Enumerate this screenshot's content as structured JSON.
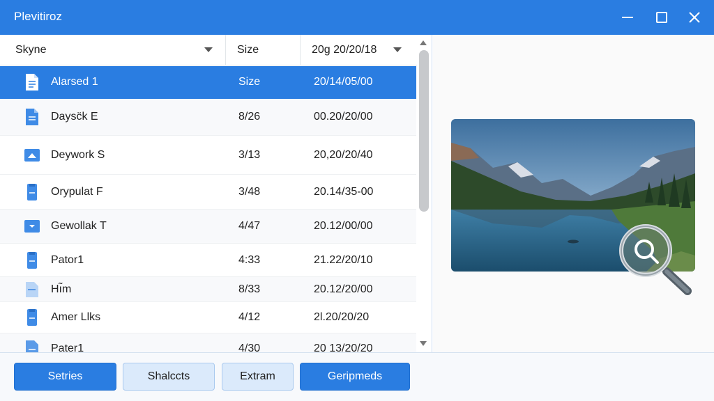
{
  "window": {
    "title": "Plevitiroz"
  },
  "list": {
    "columns": {
      "name": "Skyne",
      "size": "Size",
      "date": "20g 20/20/18"
    },
    "rows": [
      {
        "icon": "document-icon",
        "name": "Alarsed 1",
        "size": "Size",
        "date": "20/14/05/00",
        "selected": true
      },
      {
        "icon": "document-icon",
        "name": "Daysc̈k E",
        "size": "8/26",
        "date": "00.20/20/00",
        "selected": false
      },
      {
        "icon": "image-icon",
        "name": "Deywork S",
        "size": "3/13",
        "date": "20,20/20/40",
        "selected": false
      },
      {
        "icon": "document-icon",
        "name": "Orypulat F",
        "size": "3/48",
        "date": "20.14/35-00",
        "selected": false
      },
      {
        "icon": "download-icon",
        "name": "Gewollak T",
        "size": "4/47",
        "date": "20.12/00/00",
        "selected": false
      },
      {
        "icon": "document-icon",
        "name": "Pator1",
        "size": "4:33",
        "date": "21.22/20/10",
        "selected": false
      },
      {
        "icon": "document-icon",
        "name": "Hı̃m",
        "size": "8/33",
        "date": "20.12/20/00",
        "selected": false
      },
      {
        "icon": "document-icon",
        "name": "Amer Llks",
        "size": "4/12",
        "date": "2l.20/20/20",
        "selected": false
      },
      {
        "icon": "document-icon",
        "name": "Pater1",
        "size": "4/30",
        "date": "20 13/20/20",
        "selected": false
      }
    ]
  },
  "footer": {
    "buttons": [
      {
        "label": "Setries"
      },
      {
        "label": "Shalccts"
      },
      {
        "label": "Extram"
      },
      {
        "label": "Geripmeds"
      }
    ]
  },
  "colors": {
    "accent": "#2a7de1",
    "selected_row": "#2a7de1",
    "secondary_button": "#dbeafb"
  }
}
